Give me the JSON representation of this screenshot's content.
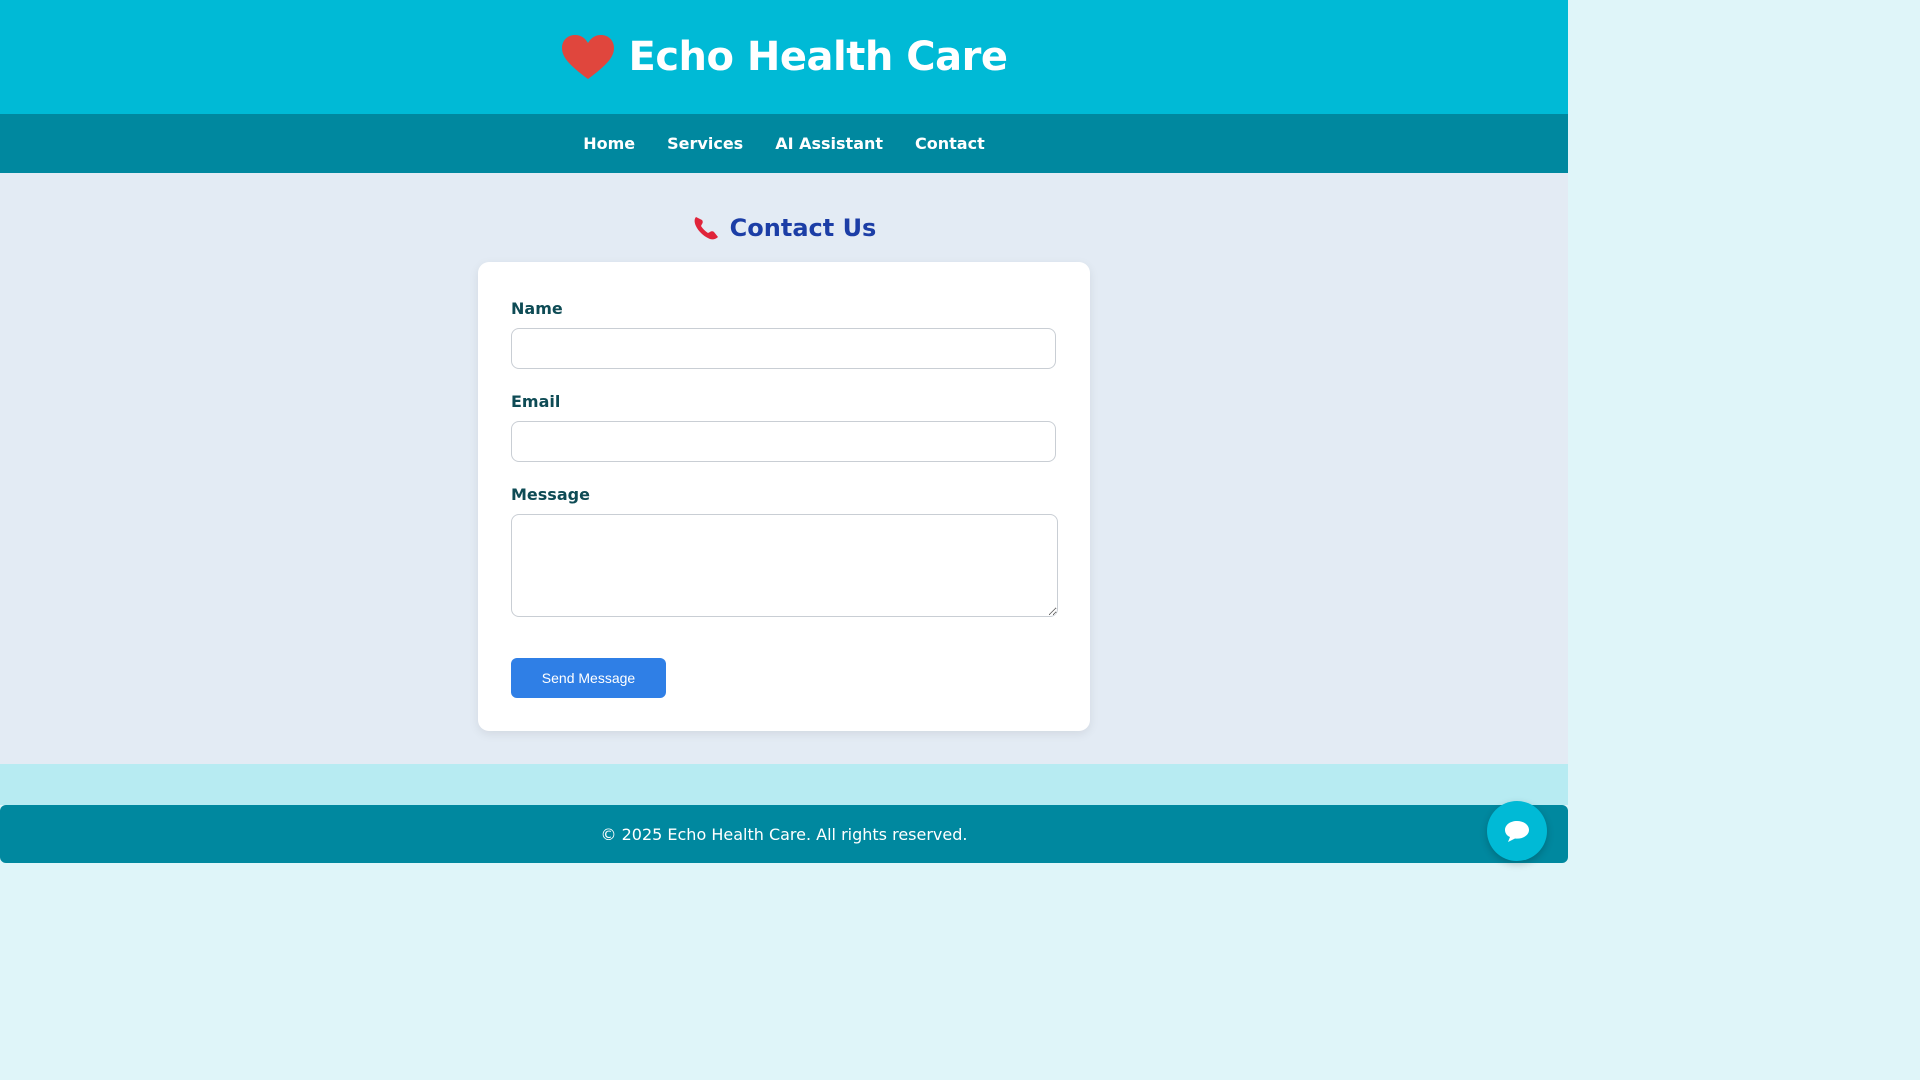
{
  "header": {
    "title": "Echo Health Care",
    "logo_icon": "heart-icon",
    "background": "#00bad6"
  },
  "nav": {
    "items": [
      {
        "label": "Home"
      },
      {
        "label": "Services"
      },
      {
        "label": "AI Assistant"
      },
      {
        "label": "Contact"
      }
    ],
    "background": "#00889f"
  },
  "contact": {
    "title": "Contact Us",
    "title_icon": "phone-icon",
    "form": {
      "name_label": "Name",
      "name_value": "",
      "email_label": "Email",
      "email_value": "",
      "message_label": "Message",
      "message_value": "",
      "submit_label": "Send Message"
    }
  },
  "footer": {
    "text": "© 2025 Echo Health Care. All rights reserved."
  },
  "chat": {
    "icon": "chat-bubble-icon"
  },
  "colors": {
    "accent": "#2f7fe6",
    "heading": "#1c3ea6",
    "heart": "#e0463d",
    "phone": "#e0243a"
  }
}
